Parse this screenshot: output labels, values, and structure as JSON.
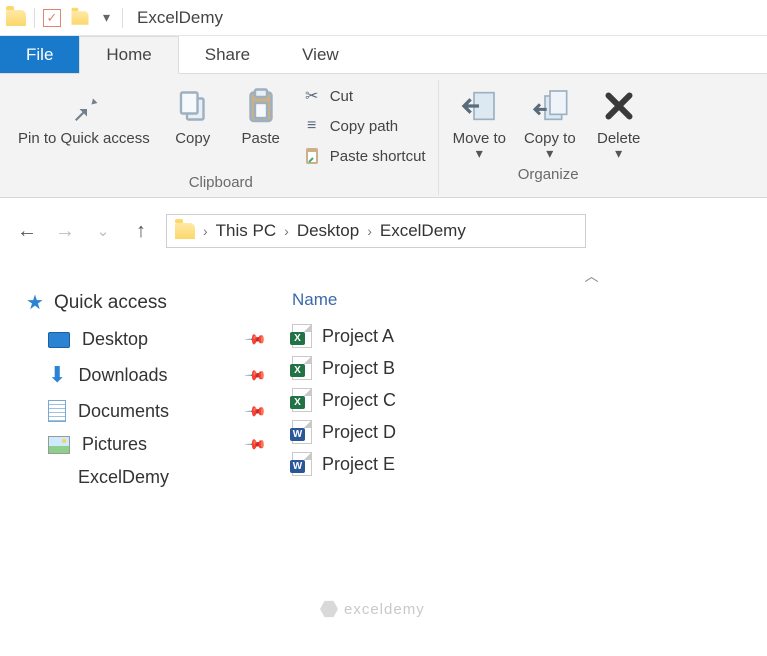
{
  "window": {
    "title": "ExcelDemy"
  },
  "tabs": {
    "file": "File",
    "home": "Home",
    "share": "Share",
    "view": "View"
  },
  "ribbon": {
    "pin": "Pin to Quick access",
    "copy": "Copy",
    "paste": "Paste",
    "cut": "Cut",
    "copypath": "Copy path",
    "pasteshortcut": "Paste shortcut",
    "clipboard_label": "Clipboard",
    "moveto": "Move to",
    "copyto": "Copy to",
    "delete": "Delete",
    "organize_label": "Organize"
  },
  "breadcrumbs": [
    "This PC",
    "Desktop",
    "ExcelDemy"
  ],
  "sidebar": {
    "quick_access": "Quick access",
    "items": [
      {
        "label": "Desktop",
        "pinned": true,
        "icon": "desktop"
      },
      {
        "label": "Downloads",
        "pinned": true,
        "icon": "downloads"
      },
      {
        "label": "Documents",
        "pinned": true,
        "icon": "documents"
      },
      {
        "label": "Pictures",
        "pinned": true,
        "icon": "pictures"
      },
      {
        "label": "ExcelDemy",
        "pinned": false,
        "icon": "folder"
      }
    ]
  },
  "content": {
    "column_header": "Name",
    "files": [
      {
        "name": "Project A",
        "type": "excel"
      },
      {
        "name": "Project B",
        "type": "excel"
      },
      {
        "name": "Project C",
        "type": "excel"
      },
      {
        "name": "Project D",
        "type": "word"
      },
      {
        "name": "Project E",
        "type": "word"
      }
    ]
  },
  "watermark": "exceldemy"
}
